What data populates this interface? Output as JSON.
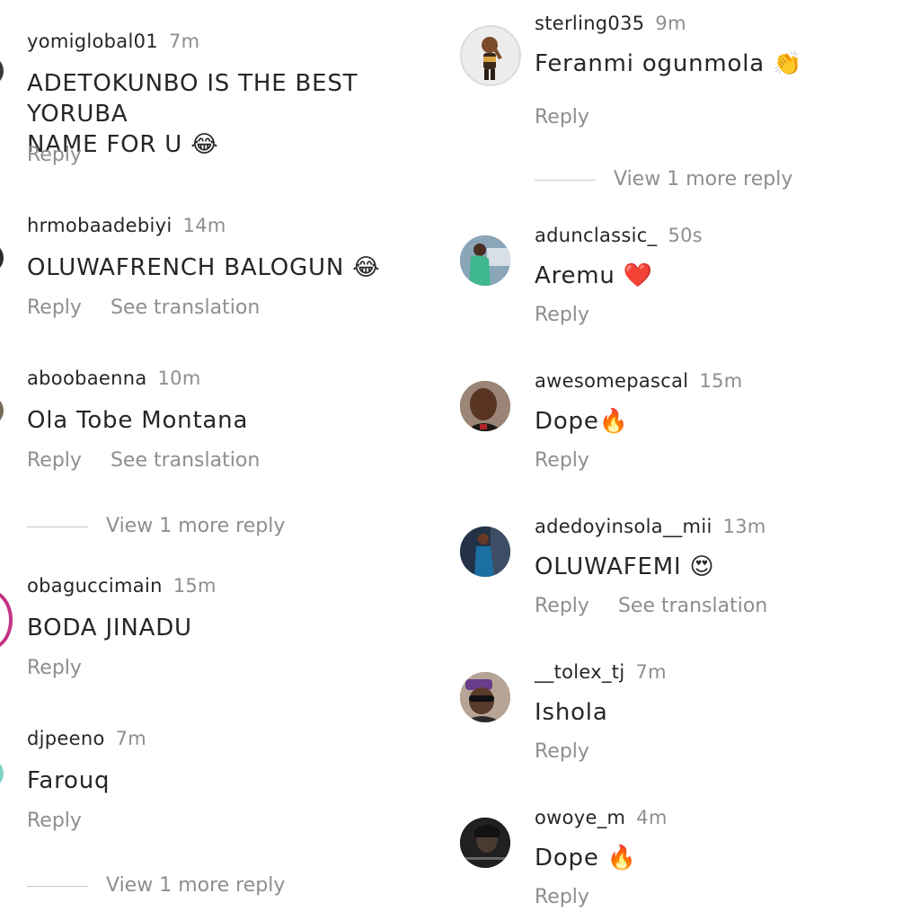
{
  "left_comments": [
    {
      "username": "yomiglobal01",
      "time": "7m",
      "text": "ADETOKUNBO IS THE BEST YORUBA\nNAME FOR U 😂",
      "reply": "Reply"
    },
    {
      "username": "hrmobaadebiyi",
      "time": "14m",
      "text": "OLUWAFRENCH BALOGUN 😂",
      "reply": "Reply",
      "translate": "See translation"
    },
    {
      "username": "aboobaenna",
      "time": "10m",
      "text": "Ola Tobe Montana",
      "reply": "Reply",
      "translate": "See translation"
    },
    {
      "username": "obaguccimain",
      "time": "15m",
      "text": "BODA JINADU",
      "reply": "Reply"
    },
    {
      "username": "djpeeno",
      "time": "7m",
      "text": "Farouq",
      "reply": "Reply"
    }
  ],
  "left_view_more": [
    "View 1 more reply",
    "View 1 more reply"
  ],
  "right_comments": [
    {
      "username": "sterling035",
      "time": "9m",
      "text": "Feranmi ogunmola 👏",
      "reply": "Reply"
    },
    {
      "username": "adunclassic_",
      "time": "50s",
      "text": "Aremu ❤️",
      "reply": "Reply"
    },
    {
      "username": "awesomepascal",
      "time": "15m",
      "text": "Dope🔥",
      "reply": "Reply"
    },
    {
      "username": "adedoyinsola__mii",
      "time": "13m",
      "text": "OLUWAFEMI 😍",
      "reply": "Reply",
      "translate": "See translation"
    },
    {
      "username": "__tolex_tj",
      "time": "7m",
      "text": "Ishola",
      "reply": "Reply"
    },
    {
      "username": "owoye_m",
      "time": "4m",
      "text": "Dope 🔥",
      "reply": "Reply"
    }
  ],
  "right_view_more": [
    "View 1 more reply"
  ],
  "colors": {
    "text": "#262626",
    "muted": "#8e8e8e",
    "divider": "#c7c7c7",
    "story_ring": "#c13584"
  }
}
